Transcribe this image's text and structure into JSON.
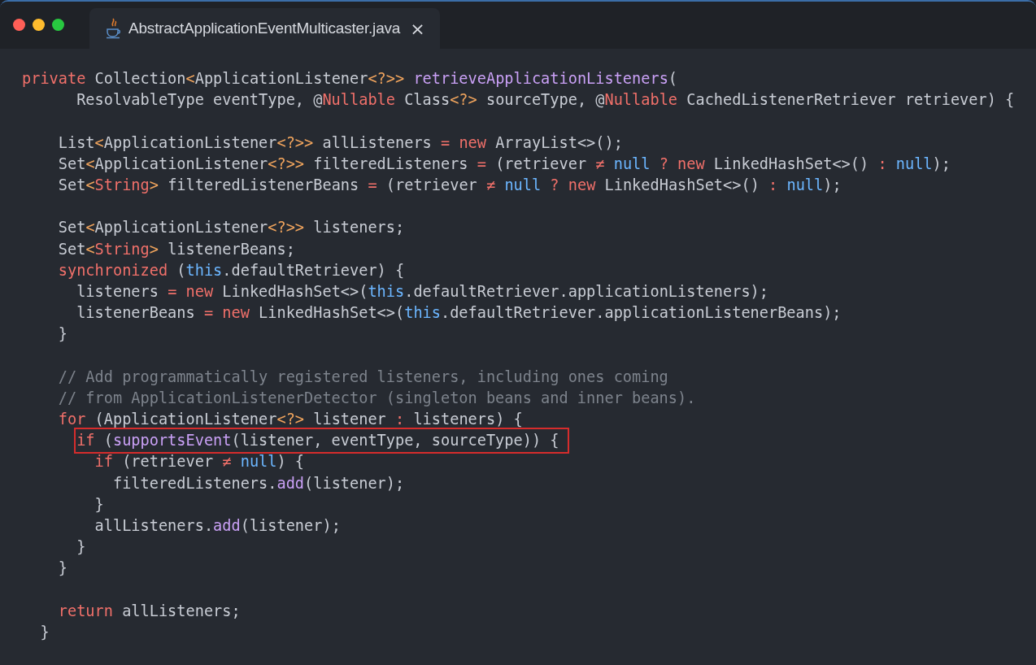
{
  "tab": {
    "title": "AbstractApplicationEventMulticaster.java",
    "close": "×"
  },
  "lines": [
    {
      "kind": "code",
      "highlighted": false,
      "tokens": [
        {
          "kind": "kw",
          "text": "private"
        },
        {
          "kind": "plain",
          "text": " Collection"
        },
        {
          "kind": "op",
          "text": "<"
        },
        {
          "kind": "plain",
          "text": "ApplicationListener"
        },
        {
          "kind": "op",
          "text": "<?>>"
        },
        {
          "kind": "fn",
          "text": " retrieveApplicationListeners"
        },
        {
          "kind": "plain",
          "text": "("
        }
      ]
    },
    {
      "kind": "code",
      "highlighted": false,
      "tokens": [
        {
          "kind": "plain",
          "text": "      ResolvableType eventType, @"
        },
        {
          "kind": "kw",
          "text": "Nullable"
        },
        {
          "kind": "plain",
          "text": " Class"
        },
        {
          "kind": "op",
          "text": "<?>"
        },
        {
          "kind": "plain",
          "text": " sourceType, @"
        },
        {
          "kind": "kw",
          "text": "Nullable"
        },
        {
          "kind": "plain",
          "text": " CachedListenerRetriever retriever) {"
        }
      ]
    },
    {
      "kind": "blank"
    },
    {
      "kind": "code",
      "highlighted": false,
      "tokens": [
        {
          "kind": "plain",
          "text": "    List"
        },
        {
          "kind": "op",
          "text": "<"
        },
        {
          "kind": "plain",
          "text": "ApplicationListener"
        },
        {
          "kind": "op",
          "text": "<?>>"
        },
        {
          "kind": "plain",
          "text": " allListeners "
        },
        {
          "kind": "kw",
          "text": "="
        },
        {
          "kind": "kw",
          "text": " new"
        },
        {
          "kind": "plain",
          "text": " ArrayList<>();"
        }
      ]
    },
    {
      "kind": "code",
      "highlighted": false,
      "tokens": [
        {
          "kind": "plain",
          "text": "    Set"
        },
        {
          "kind": "op",
          "text": "<"
        },
        {
          "kind": "plain",
          "text": "ApplicationListener"
        },
        {
          "kind": "op",
          "text": "<?>>"
        },
        {
          "kind": "plain",
          "text": " filteredListeners "
        },
        {
          "kind": "kw",
          "text": "="
        },
        {
          "kind": "plain",
          "text": " (retriever "
        },
        {
          "kind": "kw",
          "text": "≠"
        },
        {
          "kind": "lit",
          "text": " null"
        },
        {
          "kind": "kw",
          "text": " ?"
        },
        {
          "kind": "kw",
          "text": " new"
        },
        {
          "kind": "plain",
          "text": " LinkedHashSet<>() "
        },
        {
          "kind": "kw",
          "text": ":"
        },
        {
          "kind": "lit",
          "text": " null"
        },
        {
          "kind": "plain",
          "text": ");"
        }
      ]
    },
    {
      "kind": "code",
      "highlighted": false,
      "tokens": [
        {
          "kind": "plain",
          "text": "    Set"
        },
        {
          "kind": "op",
          "text": "<"
        },
        {
          "kind": "kw",
          "text": "String"
        },
        {
          "kind": "op",
          "text": ">"
        },
        {
          "kind": "plain",
          "text": " filteredListenerBeans "
        },
        {
          "kind": "kw",
          "text": "="
        },
        {
          "kind": "plain",
          "text": " (retriever "
        },
        {
          "kind": "kw",
          "text": "≠"
        },
        {
          "kind": "lit",
          "text": " null"
        },
        {
          "kind": "kw",
          "text": " ?"
        },
        {
          "kind": "kw",
          "text": " new"
        },
        {
          "kind": "plain",
          "text": " LinkedHashSet<>() "
        },
        {
          "kind": "kw",
          "text": ":"
        },
        {
          "kind": "lit",
          "text": " null"
        },
        {
          "kind": "plain",
          "text": ");"
        }
      ]
    },
    {
      "kind": "blank"
    },
    {
      "kind": "code",
      "highlighted": false,
      "tokens": [
        {
          "kind": "plain",
          "text": "    Set"
        },
        {
          "kind": "op",
          "text": "<"
        },
        {
          "kind": "plain",
          "text": "ApplicationListener"
        },
        {
          "kind": "op",
          "text": "<?>>"
        },
        {
          "kind": "plain",
          "text": " listeners;"
        }
      ]
    },
    {
      "kind": "code",
      "highlighted": false,
      "tokens": [
        {
          "kind": "plain",
          "text": "    Set"
        },
        {
          "kind": "op",
          "text": "<"
        },
        {
          "kind": "kw",
          "text": "String"
        },
        {
          "kind": "op",
          "text": ">"
        },
        {
          "kind": "plain",
          "text": " listenerBeans;"
        }
      ]
    },
    {
      "kind": "code",
      "highlighted": false,
      "tokens": [
        {
          "kind": "kw",
          "text": "    synchronized"
        },
        {
          "kind": "plain",
          "text": " ("
        },
        {
          "kind": "lit",
          "text": "this"
        },
        {
          "kind": "plain",
          "text": ".defaultRetriever) {"
        }
      ]
    },
    {
      "kind": "code",
      "highlighted": false,
      "tokens": [
        {
          "kind": "plain",
          "text": "      listeners "
        },
        {
          "kind": "kw",
          "text": "="
        },
        {
          "kind": "kw",
          "text": " new"
        },
        {
          "kind": "plain",
          "text": " LinkedHashSet<>("
        },
        {
          "kind": "lit",
          "text": "this"
        },
        {
          "kind": "plain",
          "text": ".defaultRetriever.applicationListeners);"
        }
      ]
    },
    {
      "kind": "code",
      "highlighted": false,
      "tokens": [
        {
          "kind": "plain",
          "text": "      listenerBeans "
        },
        {
          "kind": "kw",
          "text": "="
        },
        {
          "kind": "kw",
          "text": " new"
        },
        {
          "kind": "plain",
          "text": " LinkedHashSet<>("
        },
        {
          "kind": "lit",
          "text": "this"
        },
        {
          "kind": "plain",
          "text": ".defaultRetriever.applicationListenerBeans);"
        }
      ]
    },
    {
      "kind": "code",
      "highlighted": false,
      "tokens": [
        {
          "kind": "plain",
          "text": "    }"
        }
      ]
    },
    {
      "kind": "blank"
    },
    {
      "kind": "code",
      "highlighted": false,
      "tokens": [
        {
          "kind": "cm",
          "text": "    // Add programmatically registered listeners, including ones coming"
        }
      ]
    },
    {
      "kind": "code",
      "highlighted": false,
      "tokens": [
        {
          "kind": "cm",
          "text": "    // from ApplicationListenerDetector (singleton beans and inner beans)."
        }
      ]
    },
    {
      "kind": "code",
      "highlighted": false,
      "tokens": [
        {
          "kind": "kw",
          "text": "    for"
        },
        {
          "kind": "plain",
          "text": " (ApplicationListener"
        },
        {
          "kind": "op",
          "text": "<?>"
        },
        {
          "kind": "plain",
          "text": " listener "
        },
        {
          "kind": "kw",
          "text": ":"
        },
        {
          "kind": "plain",
          "text": " listeners) {"
        }
      ]
    },
    {
      "kind": "code",
      "highlighted": true,
      "tokens": [
        {
          "kind": "kw",
          "text": "      if"
        },
        {
          "kind": "plain",
          "text": " ("
        },
        {
          "kind": "fn",
          "text": "supportsEvent"
        },
        {
          "kind": "plain",
          "text": "(listener, eventType, sourceType)) {"
        }
      ]
    },
    {
      "kind": "code",
      "highlighted": false,
      "tokens": [
        {
          "kind": "kw",
          "text": "        if"
        },
        {
          "kind": "plain",
          "text": " (retriever "
        },
        {
          "kind": "kw",
          "text": "≠"
        },
        {
          "kind": "lit",
          "text": " null"
        },
        {
          "kind": "plain",
          "text": ") {"
        }
      ]
    },
    {
      "kind": "code",
      "highlighted": false,
      "tokens": [
        {
          "kind": "plain",
          "text": "          filteredListeners."
        },
        {
          "kind": "fn",
          "text": "add"
        },
        {
          "kind": "plain",
          "text": "(listener);"
        }
      ]
    },
    {
      "kind": "code",
      "highlighted": false,
      "tokens": [
        {
          "kind": "plain",
          "text": "        }"
        }
      ]
    },
    {
      "kind": "code",
      "highlighted": false,
      "tokens": [
        {
          "kind": "plain",
          "text": "        allListeners."
        },
        {
          "kind": "fn",
          "text": "add"
        },
        {
          "kind": "plain",
          "text": "(listener);"
        }
      ]
    },
    {
      "kind": "code",
      "highlighted": false,
      "tokens": [
        {
          "kind": "plain",
          "text": "      }"
        }
      ]
    },
    {
      "kind": "code",
      "highlighted": false,
      "tokens": [
        {
          "kind": "plain",
          "text": "    }"
        }
      ]
    },
    {
      "kind": "blank"
    },
    {
      "kind": "code",
      "highlighted": false,
      "tokens": [
        {
          "kind": "kw",
          "text": "    return"
        },
        {
          "kind": "plain",
          "text": " allListeners;"
        }
      ]
    },
    {
      "kind": "code",
      "highlighted": false,
      "tokens": [
        {
          "kind": "plain",
          "text": "  }"
        }
      ]
    }
  ]
}
